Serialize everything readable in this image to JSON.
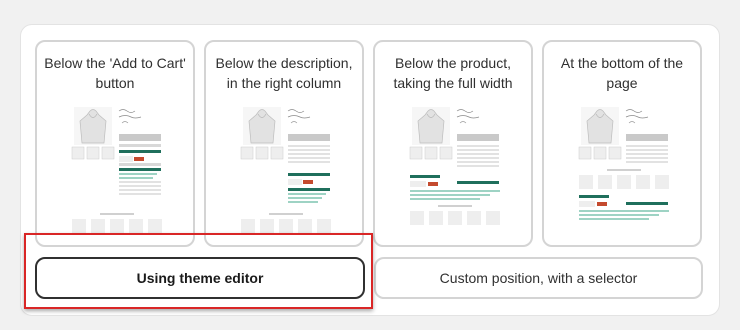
{
  "placements": [
    {
      "label": "Below the 'Add to Cart' button",
      "preview": "preview-add-to-cart"
    },
    {
      "label": "Below the description, in the right column",
      "preview": "preview-right-column"
    },
    {
      "label": "Below the product, taking the full width",
      "preview": "preview-full-width"
    },
    {
      "label": "At the bottom of the page",
      "preview": "preview-page-bottom"
    }
  ],
  "buttons": {
    "theme_editor": "Using theme editor",
    "custom_selector": "Custom position, with a selector"
  },
  "colors": {
    "accent": "#1f6f5c",
    "accent_light": "#9ed3c4",
    "sneaker": "#c44a2e",
    "highlight": "#d92626",
    "selected_border": "#303030"
  }
}
